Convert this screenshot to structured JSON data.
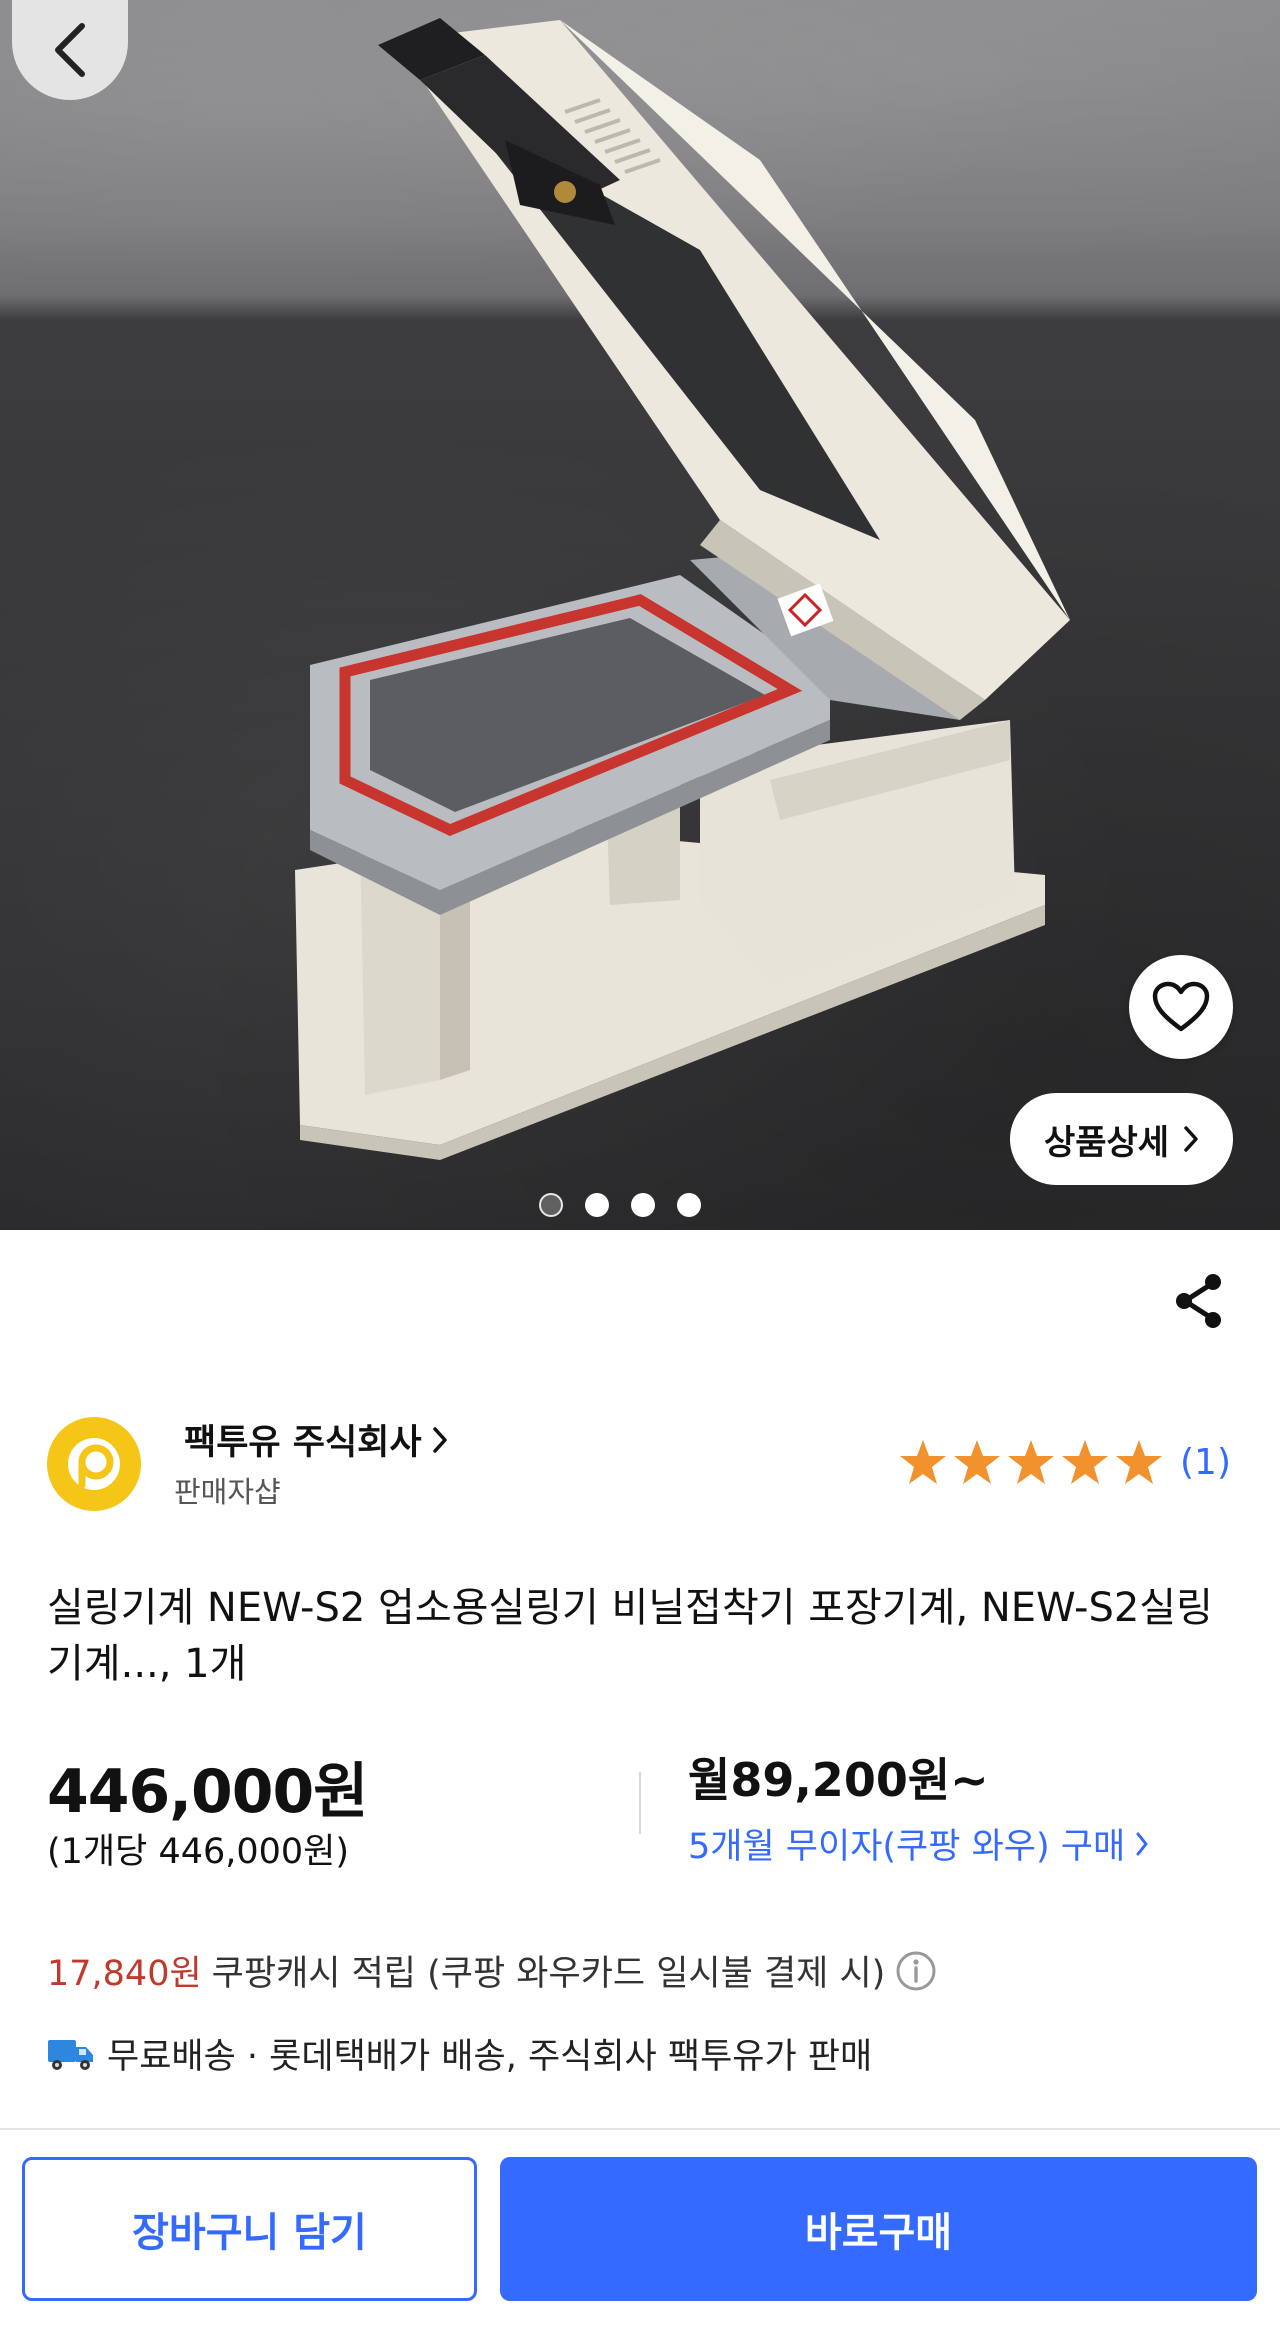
{
  "hero": {
    "image_alt": "sealing machine product photo",
    "detail_button_label": "상품상세",
    "dots": [
      {
        "active": true
      },
      {
        "active": false
      },
      {
        "active": false
      },
      {
        "active": false
      }
    ]
  },
  "seller": {
    "name": "팩투유 주식회사",
    "subtitle": "판매자샵",
    "rating_stars": 5,
    "rating_count": "(1)"
  },
  "product": {
    "title": "실링기계 NEW-S2 업소용실링기 비닐접착기 포장기계, NEW-S2실링기계..., 1개"
  },
  "price": {
    "main": "446,000원",
    "unit": "(1개당 446,000원)",
    "monthly": "월89,200원~",
    "installment_label": "5개월 무이자(쿠팡 와우) 구매"
  },
  "cash": {
    "amount": "17,840원",
    "text": "쿠팡캐시 적립 (쿠팡 와우카드 일시불 결제 시)"
  },
  "shipping": {
    "text": "무료배송 · 롯데택배가 배송, 주식회사 팩투유가 판매"
  },
  "actions": {
    "cart_label": "장바구니 담기",
    "buy_label": "바로구매"
  },
  "colors": {
    "accent": "#346aff",
    "star": "#f2922e",
    "cash_red": "#c0392b",
    "seller_logo": "#f5c518"
  }
}
